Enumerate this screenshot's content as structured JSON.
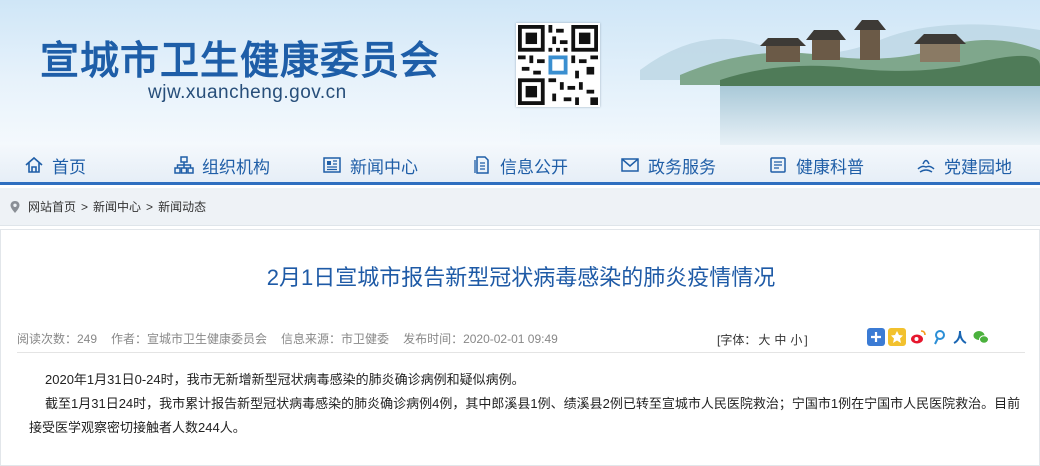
{
  "header": {
    "site_title": "宣城市卫生健康委员会",
    "site_url": "wjw.xuancheng.gov.cn",
    "brand_color": "#1e5ea8"
  },
  "nav": [
    {
      "label": "首页",
      "icon": "home-icon"
    },
    {
      "label": "组织机构",
      "icon": "org-chart-icon"
    },
    {
      "label": "新闻中心",
      "icon": "newspaper-icon"
    },
    {
      "label": "信息公开",
      "icon": "document-icon"
    },
    {
      "label": "政务服务",
      "icon": "mail-icon"
    },
    {
      "label": "健康科普",
      "icon": "book-icon"
    },
    {
      "label": "党建园地",
      "icon": "hands-icon"
    }
  ],
  "breadcrumb": [
    "网站首页",
    "新闻中心",
    "新闻动态"
  ],
  "breadcrumb_sep": ">",
  "article": {
    "title": "2月1日宣城市报告新型冠状病毒感染的肺炎疫情情况",
    "views": "阅读次数：249",
    "author": "作者：宣城市卫生健康委员会",
    "source": "信息来源：市卫健委",
    "published": "发布时间：2020-02-01 09:49",
    "font_label_open": "[字体：",
    "font_large": "大",
    "font_medium": "中",
    "font_small": "小",
    "font_label_close": "]",
    "paragraphs": [
      "2020年1月31日0-24时，我市无新增新型冠状病毒感染的肺炎确诊病例和疑似病例。",
      "截至1月31日24时，我市累计报告新型冠状病毒感染的肺炎确诊病例4例，其中郎溪县1例、绩溪县2例已转至宣城市人民医院救治；宁国市1例在宁国市人民医院救治。目前接受医学观察密切接触者人数244人。"
    ]
  },
  "share_icons": [
    "share-plus-icon",
    "qzone-icon",
    "weibo-icon",
    "tencent-weibo-icon",
    "renren-icon",
    "wechat-icon"
  ]
}
